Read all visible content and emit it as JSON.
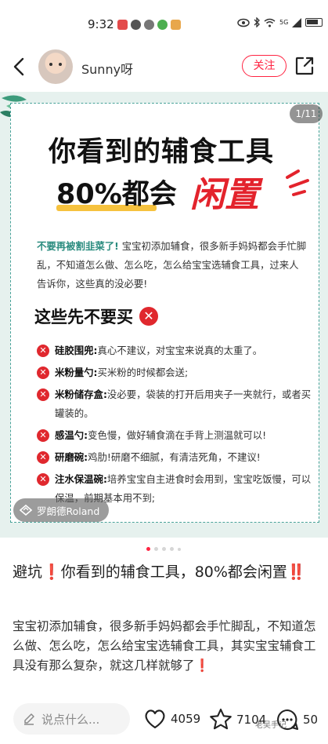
{
  "status_bar": {
    "time": "9:32",
    "signal_label": "5G"
  },
  "header": {
    "username": "Sunny呀",
    "follow_label": "关注"
  },
  "image": {
    "page_counter": "1/11",
    "title_line1": "你看到的辅食工具",
    "title_line2": "80%都会",
    "title_red": "闲置",
    "intro_highlight": "不要再被割韭菜了!",
    "intro_text": "宝宝初添加辅食，很多新手妈妈都会手忙脚乱，不知道怎么做、怎么吃，怎么给宝宝选辅食工具，过来人告诉你，这些真的没必要!",
    "section_title": "这些先不要买",
    "items": [
      {
        "name": "硅胶围兜:",
        "text": "真心不建议，对宝宝来说真的太重了。"
      },
      {
        "name": "米粉量勺:",
        "text": "买米粉的时候都会送;"
      },
      {
        "name": "米粉储存盒:",
        "text": "没必要，袋装的打开后用夹子一夹就行，或者买罐装的。"
      },
      {
        "name": "感温勺:",
        "text": "变色慢，做好辅食滴在手背上测温就可以!"
      },
      {
        "name": "研磨碗:",
        "text": "鸡肋!研磨不细腻，有清洁死角，不建议!"
      },
      {
        "name": "注水保温碗:",
        "text": "培养宝宝自主进食时会用到，宝宝吃饭慢，可以保温，前期基本用不到;"
      }
    ],
    "watermark": "罗朗德Roland",
    "total_dots": 5,
    "active_dot": 1
  },
  "post": {
    "title_prefix": "避坑",
    "title_mark1": "❗",
    "title_text": "你看到的辅食工具，80%都会闲置",
    "title_mark2": "‼️",
    "body": "宝宝初添加辅食，很多新手妈妈都会手忙脚乱，不知道怎么做、怎么吃，怎么给宝宝选辅食工具，其实宝宝辅食工具没有那么复杂，就这几样就够了",
    "body_mark": "❗"
  },
  "bottom_bar": {
    "comment_placeholder": "说点什么...",
    "likes": "4059",
    "favorites": "7104",
    "comments": "50",
    "wechat_watermark": "老吴手记"
  },
  "colors": {
    "accent": "#ff2442",
    "teal": "#2b8c7f",
    "red_title": "#e3232c"
  }
}
